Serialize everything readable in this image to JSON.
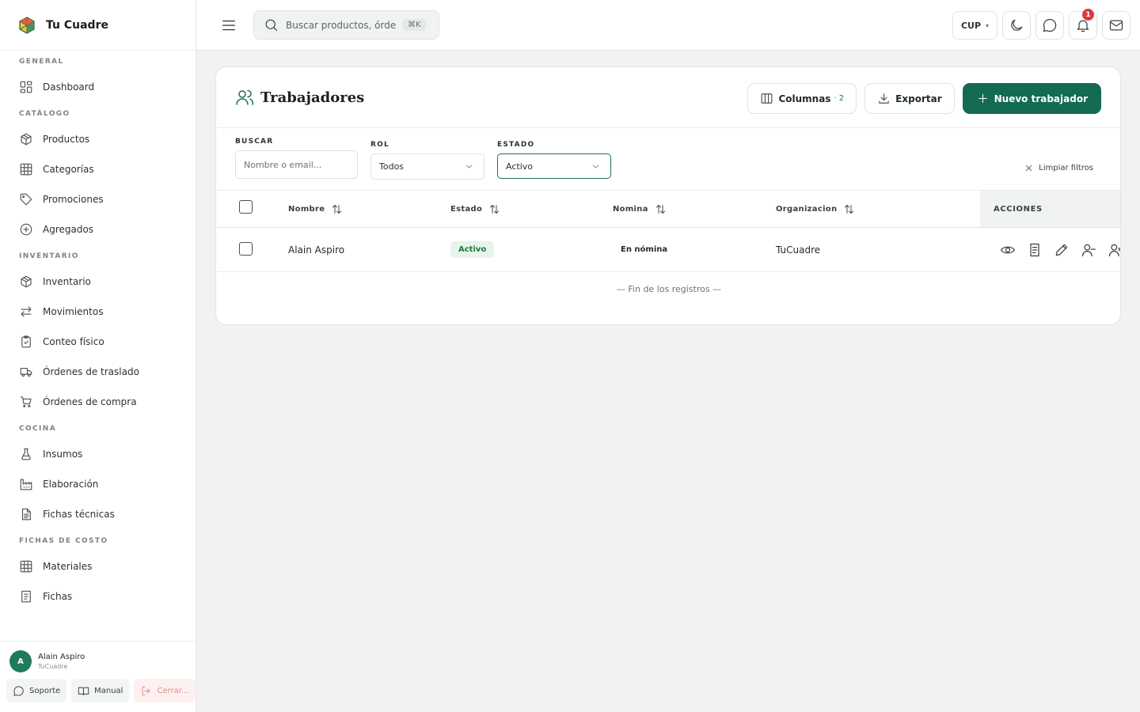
{
  "brand": {
    "name": "Tu Cuadre"
  },
  "sidebar": {
    "sections": [
      {
        "title": "GENERAL",
        "items": [
          {
            "label": "Dashboard",
            "icon": "dashboard-icon"
          }
        ]
      },
      {
        "title": "CATÁLOGO",
        "items": [
          {
            "label": "Productos",
            "icon": "box-icon"
          },
          {
            "label": "Categorías",
            "icon": "grid-icon"
          },
          {
            "label": "Promociones",
            "icon": "tag-icon"
          },
          {
            "label": "Agregados",
            "icon": "plus-circle-icon"
          }
        ]
      },
      {
        "title": "INVENTARIO",
        "items": [
          {
            "label": "Inventario",
            "icon": "box-icon"
          },
          {
            "label": "Movimientos",
            "icon": "arrows-icon"
          },
          {
            "label": "Conteo físico",
            "icon": "clipboard-check-icon"
          },
          {
            "label": "Órdenes de traslado",
            "icon": "truck-icon"
          },
          {
            "label": "Órdenes de compra",
            "icon": "cart-icon"
          }
        ]
      },
      {
        "title": "COCINA",
        "items": [
          {
            "label": "Insumos",
            "icon": "flask-icon"
          },
          {
            "label": "Elaboración",
            "icon": "factory-icon"
          },
          {
            "label": "Fichas técnicas",
            "icon": "document-icon"
          }
        ]
      },
      {
        "title": "FICHAS DE COSTO",
        "items": [
          {
            "label": "Materiales",
            "icon": "grid-icon"
          },
          {
            "label": "Fichas",
            "icon": "document-icon"
          }
        ]
      }
    ],
    "user": {
      "initial": "A",
      "name": "Alain Aspiro",
      "org": "TuCuadre"
    },
    "footer": {
      "support": "Soporte",
      "manual": "Manual",
      "logout": "Cerrar..."
    }
  },
  "topbar": {
    "search_placeholder": "Buscar productos, órdenes...",
    "shortcut": "⌘K",
    "currency": "CUP",
    "notifications_count": "1"
  },
  "page": {
    "title": "Trabajadores",
    "columns_label": "Columnas",
    "columns_count": "· 2",
    "export_label": "Exportar",
    "new_label": "Nuevo trabajador"
  },
  "filters": {
    "search_label": "BUSCAR",
    "search_placeholder": "Nombre o email...",
    "role_label": "ROL",
    "role_value": "Todos",
    "status_label": "ESTADO",
    "status_value": "Activo",
    "clear_label": "Limpiar filtros"
  },
  "table": {
    "headers": {
      "name": "Nombre",
      "status": "Estado",
      "payroll": "Nomina",
      "org": "Organizacion",
      "actions": "ACCIONES"
    },
    "rows": [
      {
        "name": "Alain Aspiro",
        "status": "Activo",
        "payroll": "En nómina",
        "org": "TuCuadre"
      }
    ],
    "end_text": "— Fin de los registros —"
  },
  "colors": {
    "accent": "#136b51",
    "status_bg": "#e6f4ea",
    "status_fg": "#1f7a3e",
    "badge": "#dc3a3a"
  }
}
